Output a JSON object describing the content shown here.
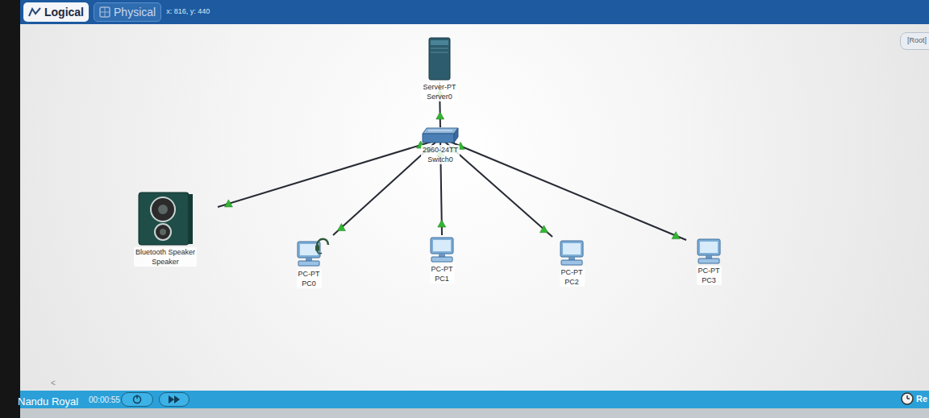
{
  "workspace_tabs": [
    {
      "label": "Logical",
      "selected": true
    },
    {
      "label": "Physical",
      "selected": false
    }
  ],
  "cursor_position": "x: 816, y: 440",
  "cluster_label": "[Root]",
  "devices": [
    {
      "model": "Server-PT",
      "name": "Server0",
      "kind": "server",
      "headset": false
    },
    {
      "model": "2960-24TT",
      "name": "Switch0",
      "kind": "switch",
      "headset": false
    },
    {
      "model": "Bluetooth Speaker",
      "name": "Speaker",
      "kind": "speaker",
      "headset": false
    },
    {
      "model": "PC-PT",
      "name": "PC0",
      "kind": "pc",
      "headset": true
    },
    {
      "model": "PC-PT",
      "name": "PC1",
      "kind": "pc",
      "headset": false
    },
    {
      "model": "PC-PT",
      "name": "PC2",
      "kind": "pc",
      "headset": false
    },
    {
      "model": "PC-PT",
      "name": "PC3",
      "kind": "pc",
      "headset": false
    }
  ],
  "links": [
    {
      "from": 1,
      "to": 0,
      "up": true
    },
    {
      "from": 1,
      "to": 2,
      "up": true
    },
    {
      "from": 1,
      "to": 3,
      "up": true
    },
    {
      "from": 1,
      "to": 4,
      "up": true
    },
    {
      "from": 1,
      "to": 5,
      "up": true
    },
    {
      "from": 1,
      "to": 6,
      "up": true
    }
  ],
  "scroll_arrow": "<",
  "time": "00:00:55",
  "realtime_label": "Re",
  "watermark": "Nandu Royal"
}
